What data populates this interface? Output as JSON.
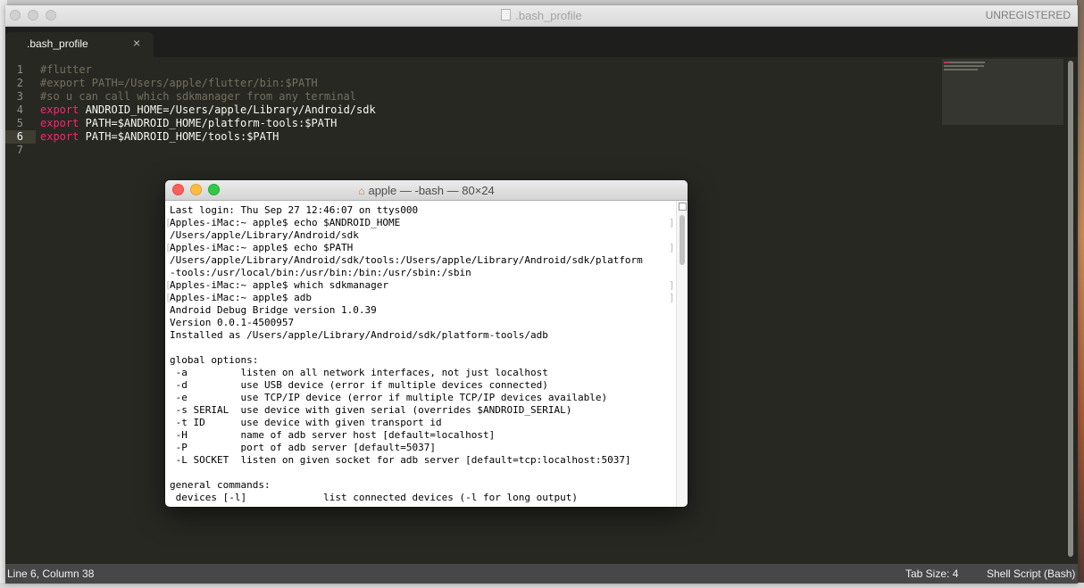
{
  "sublime": {
    "title": ".bash_profile",
    "unregistered": "UNREGISTERED",
    "tab": {
      "label": ".bash_profile",
      "close": "×"
    },
    "lines": [
      {
        "n": "1",
        "segments": [
          {
            "t": "#flutter",
            "c": "cm"
          }
        ]
      },
      {
        "n": "2",
        "segments": [
          {
            "t": "#export PATH=/Users/apple/flutter/bin:$PATH",
            "c": "cm"
          }
        ]
      },
      {
        "n": "3",
        "segments": [
          {
            "t": "#so u can call which sdkmanager from any terminal",
            "c": "cm"
          }
        ]
      },
      {
        "n": "4",
        "segments": [
          {
            "t": "export",
            "c": "kw"
          },
          {
            "t": " ANDROID_HOME=/Users/apple/Library/Android/sdk",
            "c": ""
          }
        ]
      },
      {
        "n": "5",
        "segments": [
          {
            "t": "export",
            "c": "kw"
          },
          {
            "t": " PATH=$ANDROID_HOME/platform-tools:$PATH",
            "c": ""
          }
        ]
      },
      {
        "n": "6",
        "segments": [
          {
            "t": "export",
            "c": "kw"
          },
          {
            "t": " PATH=$ANDROID_HOME/tools:$PATH",
            "c": ""
          }
        ]
      },
      {
        "n": "7",
        "segments": []
      }
    ],
    "current_line": "6",
    "status": {
      "position": "Line 6, Column 38",
      "tab_size": "Tab Size: 4",
      "syntax": "Shell Script (Bash)"
    }
  },
  "terminal": {
    "title": "apple — -bash — 80×24",
    "lines": [
      {
        "t": "Last login: Thu Sep 27 12:46:07 on ttys000",
        "mark": false
      },
      {
        "t": "Apples-iMac:~ apple$ echo $ANDROID_HOME",
        "mark": true
      },
      {
        "t": "/Users/apple/Library/Android/sdk",
        "mark": false
      },
      {
        "t": "Apples-iMac:~ apple$ echo $PATH",
        "mark": true
      },
      {
        "t": "/Users/apple/Library/Android/sdk/tools:/Users/apple/Library/Android/sdk/platform",
        "mark": false
      },
      {
        "t": "-tools:/usr/local/bin:/usr/bin:/bin:/usr/sbin:/sbin",
        "mark": false
      },
      {
        "t": "Apples-iMac:~ apple$ which sdkmanager",
        "mark": true
      },
      {
        "t": "Apples-iMac:~ apple$ adb",
        "mark": true
      },
      {
        "t": "Android Debug Bridge version 1.0.39",
        "mark": false
      },
      {
        "t": "Version 0.0.1-4500957",
        "mark": false
      },
      {
        "t": "Installed as /Users/apple/Library/Android/sdk/platform-tools/adb",
        "mark": false
      },
      {
        "t": "",
        "mark": false
      },
      {
        "t": "global options:",
        "mark": false
      },
      {
        "t": " -a         listen on all network interfaces, not just localhost",
        "mark": false
      },
      {
        "t": " -d         use USB device (error if multiple devices connected)",
        "mark": false
      },
      {
        "t": " -e         use TCP/IP device (error if multiple TCP/IP devices available)",
        "mark": false
      },
      {
        "t": " -s SERIAL  use device with given serial (overrides $ANDROID_SERIAL)",
        "mark": false
      },
      {
        "t": " -t ID      use device with given transport id",
        "mark": false
      },
      {
        "t": " -H         name of adb server host [default=localhost]",
        "mark": false
      },
      {
        "t": " -P         port of adb server [default=5037]",
        "mark": false
      },
      {
        "t": " -L SOCKET  listen on given socket for adb server [default=tcp:localhost:5037]",
        "mark": false
      },
      {
        "t": "",
        "mark": false
      },
      {
        "t": "general commands:",
        "mark": false
      },
      {
        "t": " devices [-l]             list connected devices (-l for long output)",
        "mark": false
      }
    ]
  },
  "colors": {
    "editor_bg": "#272822",
    "comment": "#75715e",
    "keyword": "#f92672",
    "text": "#f8f8f2"
  },
  "icons": {
    "terminal_title": "home-icon",
    "sublime_title": "document-icon"
  }
}
